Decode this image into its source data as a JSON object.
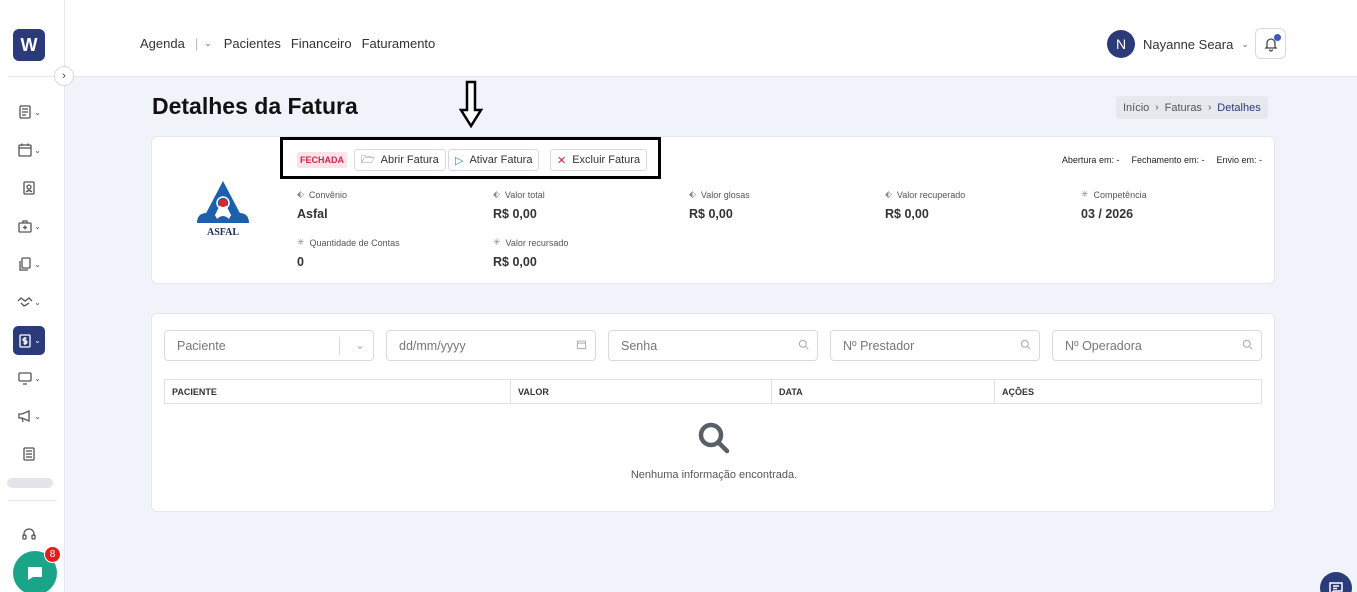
{
  "app": {
    "logo_letter": "W"
  },
  "topnav": {
    "items": [
      "Agenda",
      "Pacientes",
      "Financeiro",
      "Faturamento"
    ]
  },
  "user": {
    "initial": "N",
    "name": "Nayanne Seara"
  },
  "page": {
    "title": "Detalhes da Fatura"
  },
  "breadcrumb": {
    "items": [
      "Início",
      "Faturas",
      "Detalhes"
    ]
  },
  "invoice": {
    "status": "FECHADA",
    "actions": {
      "open": "Abrir Fatura",
      "activate": "Ativar Fatura",
      "delete": "Excluir Fatura"
    },
    "dates": {
      "abertura": "Abertura em: -",
      "fechamento": "Fechamento em: -",
      "envio": "Envio em: -"
    },
    "brand_text": "ASFAL",
    "fields": [
      {
        "label": "Convênio",
        "value": "Asfal"
      },
      {
        "label": "Valor total",
        "value": "R$ 0,00"
      },
      {
        "label": "Valor glosas",
        "value": "R$ 0,00"
      },
      {
        "label": "Valor recuperado",
        "value": "R$ 0,00"
      },
      {
        "label": "Competência",
        "value": "03 / 2026"
      },
      {
        "label": "Quantidade de Contas",
        "value": "0"
      },
      {
        "label": "Valor recursado",
        "value": "R$ 0,00"
      }
    ]
  },
  "filters": {
    "patient_placeholder": "Paciente",
    "date_placeholder": "dd/mm/yyyy",
    "senha_placeholder": "Senha",
    "prestador_placeholder": "Nº Prestador",
    "operadora_placeholder": "Nº Operadora"
  },
  "table": {
    "columns": [
      "PACIENTE",
      "VALOR",
      "DATA",
      "AÇÕES"
    ],
    "empty_text": "Nenhuma informação encontrada."
  },
  "chat": {
    "badge": "8"
  },
  "colors": {
    "primary": "#2b3a78",
    "danger": "#d7254c",
    "chat": "#1aa589"
  }
}
